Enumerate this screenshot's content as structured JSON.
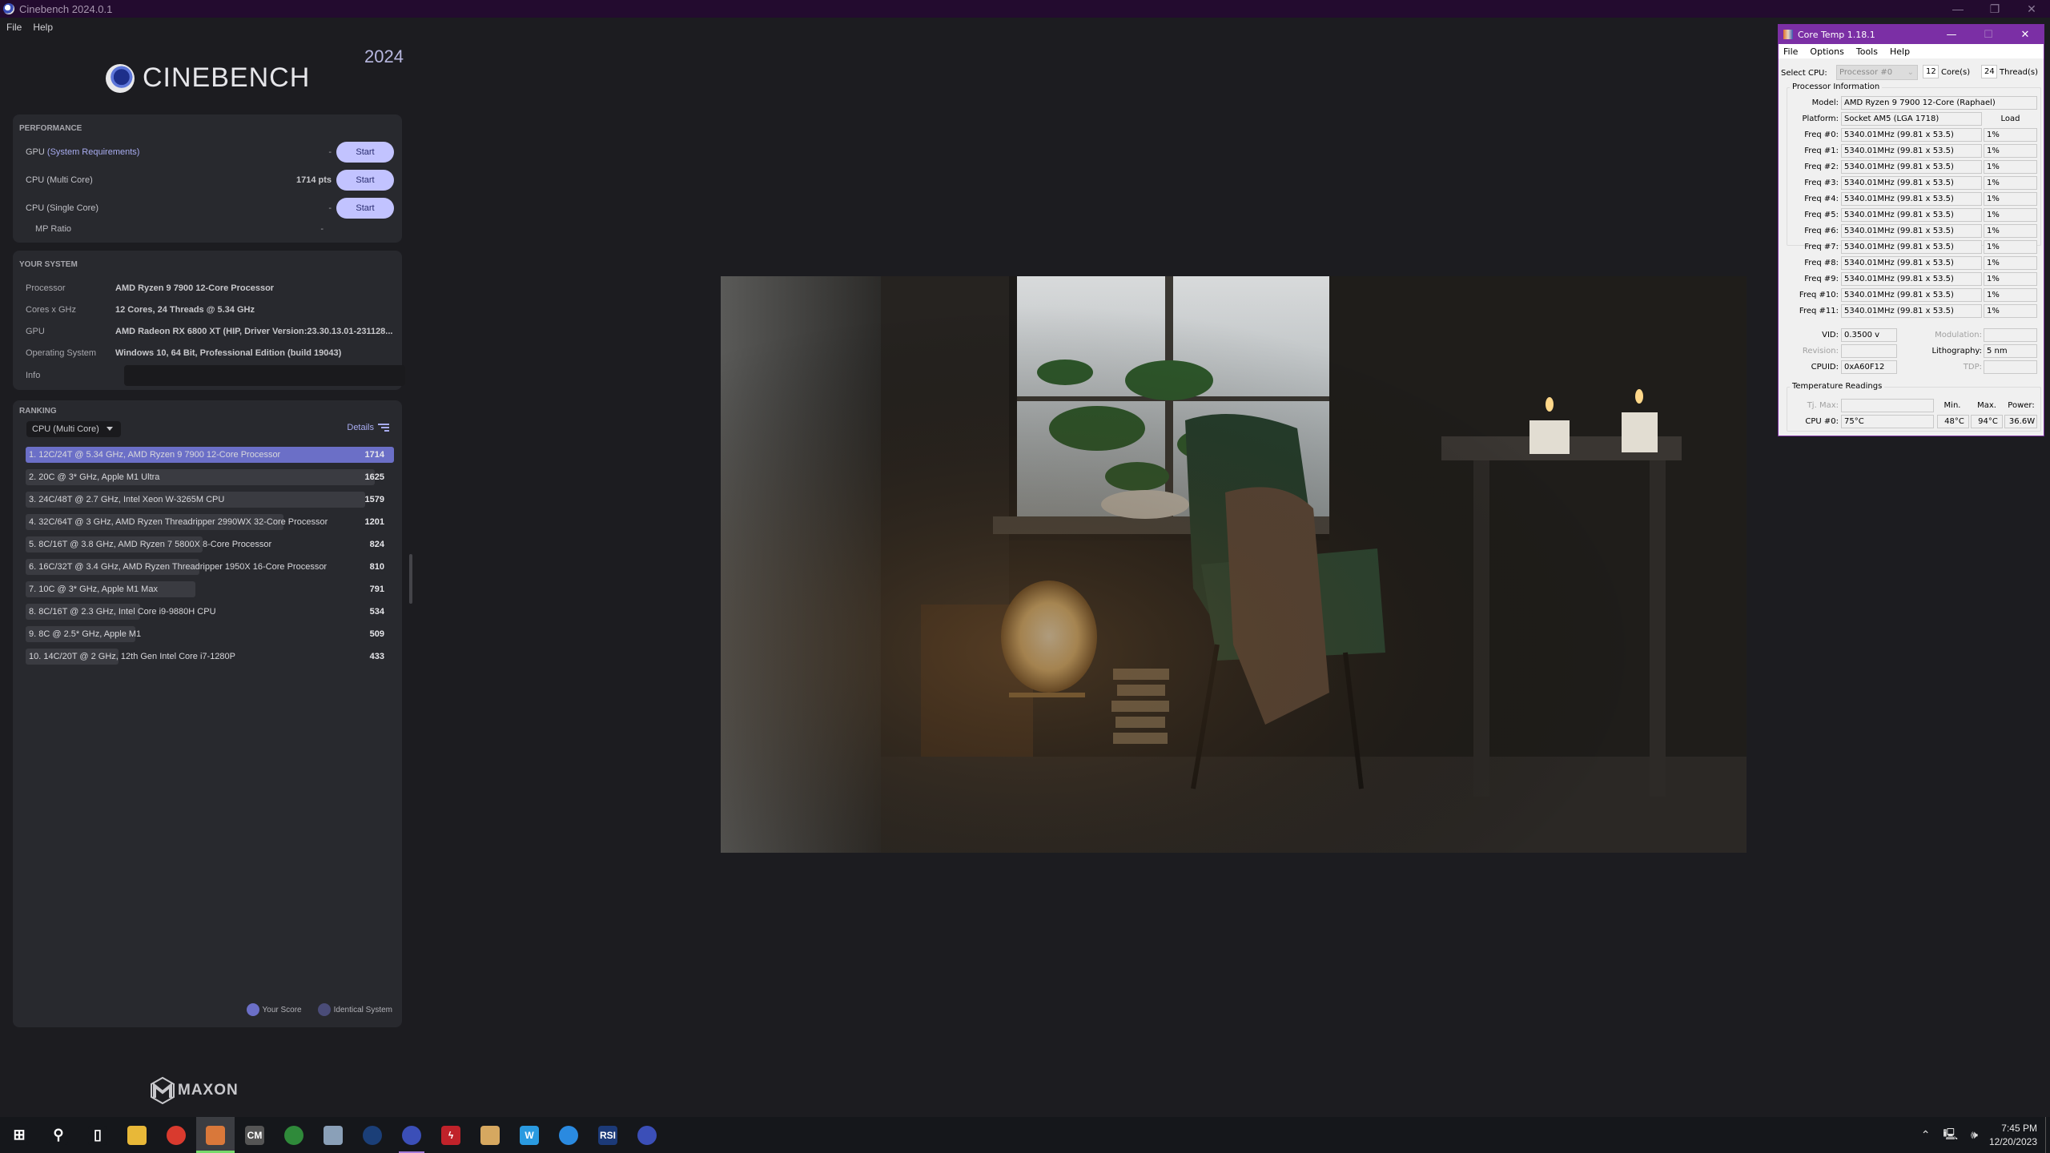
{
  "window": {
    "title": "Cinebench 2024.0.1",
    "controls": [
      "minimize",
      "restore",
      "close"
    ]
  },
  "menu": [
    "File",
    "Help"
  ],
  "brand": {
    "logo_text": "CINEBENCH",
    "year": "2024",
    "footer_logo": "MAXON"
  },
  "performance": {
    "header": "PERFORMANCE",
    "rows": [
      {
        "label": "GPU",
        "sub_label": "(System Requirements)",
        "value": "-",
        "button": "Start"
      },
      {
        "label": "CPU (Multi Core)",
        "sub_label": "",
        "value": "1714 pts",
        "button": "Start"
      },
      {
        "label": "CPU (Single Core)",
        "sub_label": "",
        "value": "-",
        "button": "Start"
      }
    ],
    "mp_ratio": {
      "label": "MP Ratio",
      "value": "-"
    }
  },
  "system": {
    "header": "YOUR SYSTEM",
    "rows": [
      {
        "key": "Processor",
        "value": "AMD Ryzen 9 7900 12-Core Processor"
      },
      {
        "key": "Cores x GHz",
        "value": "12 Cores, 24 Threads @ 5.34 GHz"
      },
      {
        "key": "GPU",
        "value": "AMD Radeon RX 6800 XT (HIP, Driver Version:23.30.13.01-231128..."
      },
      {
        "key": "Operating System",
        "value": "Windows 10, 64 Bit, Professional Edition (build 19043)"
      },
      {
        "key": "Info",
        "value": ""
      }
    ]
  },
  "ranking": {
    "header": "RANKING",
    "selected_test": "CPU (Multi Core)",
    "details_label": "Details",
    "max_score": 1714,
    "items": [
      {
        "label": "1. 12C/24T @ 5.34 GHz, AMD Ryzen 9 7900 12-Core Processor",
        "score": 1714,
        "mine": true
      },
      {
        "label": "2. 20C @ 3* GHz, Apple M1 Ultra",
        "score": 1625,
        "mine": false
      },
      {
        "label": "3. 24C/48T @ 2.7 GHz, Intel Xeon W-3265M CPU",
        "score": 1579,
        "mine": false
      },
      {
        "label": "4. 32C/64T @ 3 GHz, AMD Ryzen Threadripper 2990WX 32-Core Processor",
        "score": 1201,
        "mine": false
      },
      {
        "label": "5. 8C/16T @ 3.8 GHz, AMD Ryzen 7 5800X 8-Core Processor",
        "score": 824,
        "mine": false
      },
      {
        "label": "6. 16C/32T @ 3.4 GHz, AMD Ryzen Threadripper 1950X 16-Core Processor",
        "score": 810,
        "mine": false
      },
      {
        "label": "7. 10C @ 3* GHz, Apple M1 Max",
        "score": 791,
        "mine": false
      },
      {
        "label": "8. 8C/16T @ 2.3 GHz, Intel Core i9-9880H CPU",
        "score": 534,
        "mine": false
      },
      {
        "label": "9. 8C @ 2.5* GHz, Apple M1",
        "score": 509,
        "mine": false
      },
      {
        "label": "10. 14C/20T @ 2 GHz, 12th Gen Intel Core i7-1280P",
        "score": 433,
        "mine": false
      }
    ],
    "legend": [
      {
        "label": "Your Score",
        "color": "#6b6fc7"
      },
      {
        "label": "Identical System",
        "color": "#4a4c78"
      }
    ]
  },
  "render_preview": {
    "description": "Render of a dim room with green armchair, plants, lamp and candles"
  },
  "coretemp": {
    "title": "Core Temp 1.18.1",
    "menu": [
      "File",
      "Options",
      "Tools",
      "Help"
    ],
    "select_cpu_label": "Select CPU:",
    "select_cpu_value": "Processor #0",
    "cores": "12",
    "cores_label": "Core(s)",
    "threads": "24",
    "threads_label": "Thread(s)",
    "processor_info_title": "Processor Information",
    "model_label": "Model:",
    "model": "AMD Ryzen 9 7900 12-Core (Raphael)",
    "platform_label": "Platform:",
    "platform": "Socket AM5 (LGA 1718)",
    "load_label": "Load",
    "freqs": [
      {
        "label": "Freq #0:",
        "value": "5340.01MHz (99.81 x 53.5)",
        "load": "1%"
      },
      {
        "label": "Freq #1:",
        "value": "5340.01MHz (99.81 x 53.5)",
        "load": "1%"
      },
      {
        "label": "Freq #2:",
        "value": "5340.01MHz (99.81 x 53.5)",
        "load": "1%"
      },
      {
        "label": "Freq #3:",
        "value": "5340.01MHz (99.81 x 53.5)",
        "load": "1%"
      },
      {
        "label": "Freq #4:",
        "value": "5340.01MHz (99.81 x 53.5)",
        "load": "1%"
      },
      {
        "label": "Freq #5:",
        "value": "5340.01MHz (99.81 x 53.5)",
        "load": "1%"
      },
      {
        "label": "Freq #6:",
        "value": "5340.01MHz (99.81 x 53.5)",
        "load": "1%"
      },
      {
        "label": "Freq #7:",
        "value": "5340.01MHz (99.81 x 53.5)",
        "load": "1%"
      },
      {
        "label": "Freq #8:",
        "value": "5340.01MHz (99.81 x 53.5)",
        "load": "1%"
      },
      {
        "label": "Freq #9:",
        "value": "5340.01MHz (99.81 x 53.5)",
        "load": "1%"
      },
      {
        "label": "Freq #10:",
        "value": "5340.01MHz (99.81 x 53.5)",
        "load": "1%"
      },
      {
        "label": "Freq #11:",
        "value": "5340.01MHz (99.81 x 53.5)",
        "load": "1%"
      }
    ],
    "vid_label": "VID:",
    "vid": "0.3500 v",
    "modulation_label": "Modulation:",
    "modulation": "",
    "revision_label": "Revision:",
    "revision": "",
    "lithography_label": "Lithography:",
    "lithography": "5 nm",
    "cpuid_label": "CPUID:",
    "cpuid": "0xA60F12",
    "tdp_label": "TDP:",
    "tdp": "",
    "temp_title": "Temperature Readings",
    "tjmax_label": "Tj. Max:",
    "tjmax": "",
    "min_label": "Min.",
    "max_label": "Max.",
    "power_label": "Power:",
    "cpu0_label": "CPU #0:",
    "cpu0_temp": "75°C",
    "cpu0_min": "48°C",
    "cpu0_max": "94°C",
    "cpu0_power": "36.6W"
  },
  "taskbar": {
    "apps": [
      {
        "name": "start",
        "glyph": "⊞",
        "color": "#15171b"
      },
      {
        "name": "search",
        "glyph": "⚲",
        "color": "#15171b"
      },
      {
        "name": "task-view",
        "glyph": "▯",
        "color": "#15171b"
      },
      {
        "name": "file-explorer",
        "glyph": "",
        "color": "#e8b838"
      },
      {
        "name": "chrome",
        "glyph": "",
        "color": "#d93a2e"
      },
      {
        "name": "core-temp",
        "glyph": "",
        "color": "#d9783a"
      },
      {
        "name": "cooler-master",
        "glyph": "CM",
        "color": "#555"
      },
      {
        "name": "xbox-app",
        "glyph": "",
        "color": "#2f8a3a"
      },
      {
        "name": "paint-app",
        "glyph": "",
        "color": "#8aa0b8"
      },
      {
        "name": "steam",
        "glyph": "",
        "color": "#1b3f78"
      },
      {
        "name": "cinebench",
        "glyph": "",
        "color": "#3b4fb8"
      },
      {
        "name": "red-lightning-app",
        "glyph": "ϟ",
        "color": "#c0222a"
      },
      {
        "name": "tornado-app",
        "glyph": "",
        "color": "#d6a860"
      },
      {
        "name": "wacom-app",
        "glyph": "W",
        "color": "#2a9ae0"
      },
      {
        "name": "blue-circle-app",
        "glyph": "",
        "color": "#2a8ae0"
      },
      {
        "name": "rsi-launcher",
        "glyph": "RSI",
        "color": "#1c3a78"
      },
      {
        "name": "cinebench-2",
        "glyph": "",
        "color": "#3b4fb8"
      }
    ],
    "time": "7:45 PM",
    "date": "12/20/2023"
  }
}
